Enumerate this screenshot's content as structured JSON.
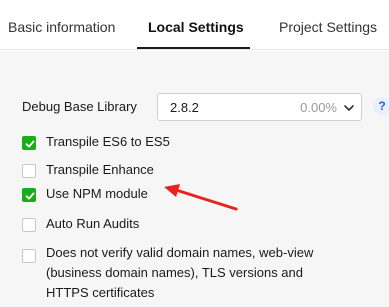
{
  "tabs": [
    {
      "label": "Basic information",
      "active": false
    },
    {
      "label": "Local Settings",
      "active": true
    },
    {
      "label": "Project Settings",
      "active": false
    }
  ],
  "debug_library": {
    "label": "Debug Base Library",
    "value": "2.8.2",
    "usage": "0.00%",
    "help": "?"
  },
  "options": [
    {
      "label": "Transpile ES6 to ES5",
      "checked": true
    },
    {
      "label": "Transpile Enhance",
      "checked": false
    },
    {
      "label": "Use NPM module",
      "checked": true
    },
    {
      "label": "Auto Run Audits",
      "checked": false
    },
    {
      "label": "Does not verify valid domain names, web-view (business domain names), TLS versions and HTTPS certificates",
      "checked": false
    }
  ],
  "colors": {
    "check_on": "#1aad19",
    "annotation_arrow": "#e8231e",
    "help_icon": "#2f5bd9"
  }
}
